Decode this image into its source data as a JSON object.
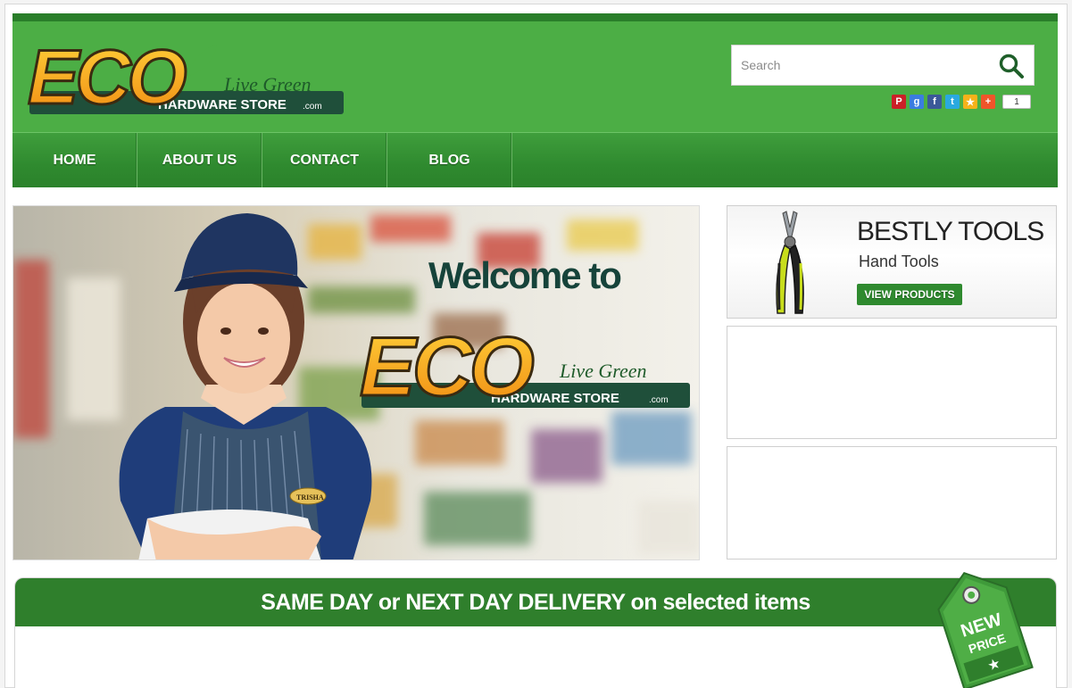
{
  "brand": {
    "logo_main": "ECO",
    "logo_tagline": "Live Green",
    "logo_sub": "HARDWARE STORE",
    "logo_suffix": ".com"
  },
  "search": {
    "placeholder": "Search"
  },
  "social": {
    "buttons": [
      {
        "icon": "pinterest-icon",
        "glyph": "P",
        "color": "#cb2027"
      },
      {
        "icon": "google-plus-icon",
        "glyph": "g",
        "color": "#3b7de0"
      },
      {
        "icon": "facebook-icon",
        "glyph": "f",
        "color": "#3b5998"
      },
      {
        "icon": "twitter-icon",
        "glyph": "t",
        "color": "#2aa9e0"
      },
      {
        "icon": "favorite-star-icon",
        "glyph": "★",
        "color": "#f5b21a"
      },
      {
        "icon": "add-plus-icon",
        "glyph": "+",
        "color": "#f0552a"
      }
    ],
    "count": "1"
  },
  "nav": {
    "items": [
      "HOME",
      "ABOUT US",
      "CONTACT",
      "BLOG"
    ]
  },
  "hero": {
    "welcome": "Welcome to",
    "logo_main": "ECO",
    "logo_tagline": "Live Green",
    "logo_sub": "HARDWARE STORE",
    "logo_suffix": ".com",
    "badge_name": "TRISHA"
  },
  "sidebar": {
    "promo": {
      "title": "BESTLY TOOLS",
      "subtitle": "Hand Tools",
      "button": "VIEW PRODUCTS"
    }
  },
  "delivery": {
    "text": "SAME DAY or NEXT DAY DELIVERY on selected items",
    "tag_line1": "NEW",
    "tag_line2": "PRICE"
  },
  "colors": {
    "header_green": "#4cae45",
    "nav_green": "#2f8a2f",
    "dark_green": "#2f7f2c",
    "logo_orange": "#f39c12"
  }
}
